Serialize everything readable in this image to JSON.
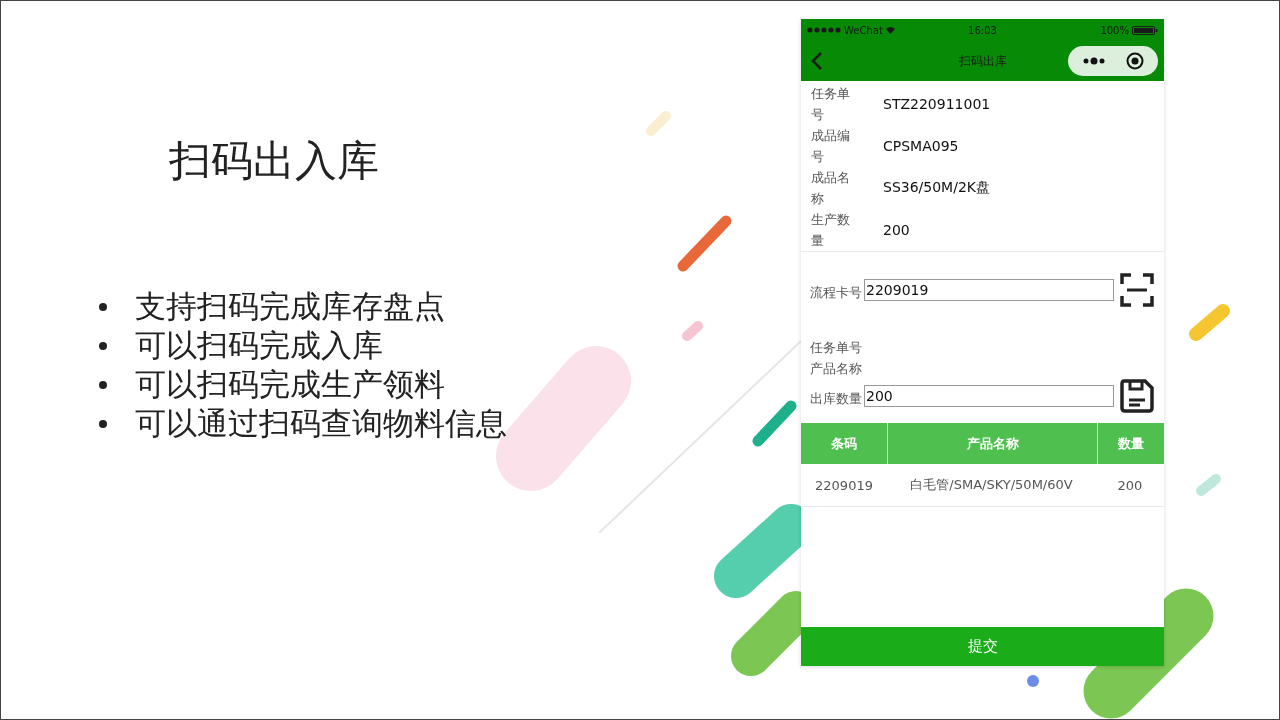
{
  "slide": {
    "title": "扫码出入库",
    "bullets": [
      "支持扫码完成库存盘点",
      "可以扫码完成入库",
      "可以扫码完成生产领料",
      "可以通过扫码查询物料信息"
    ]
  },
  "phone": {
    "status_bar": {
      "carrier": "WeChat",
      "time": "16:03",
      "battery": "100%"
    },
    "nav_title": "扫码出库",
    "info": [
      {
        "label": "任务单号",
        "value": "STZ220911001"
      },
      {
        "label": "成品编号",
        "value": "CPSMA095"
      },
      {
        "label": "成品名称",
        "value": "SS36/50M/2K盘"
      },
      {
        "label": "生产数量",
        "value": "200"
      }
    ],
    "card_field": {
      "label": "流程卡号",
      "value": "2209019"
    },
    "details": [
      "任务单号",
      "产品名称"
    ],
    "quantity_field": {
      "label": "出库数量",
      "value": "200"
    },
    "table": {
      "columns": [
        "条码",
        "产品名称",
        "数量"
      ],
      "rows": [
        [
          "2209019",
          "白毛管/SMA/SKY/50M/60V",
          "200"
        ]
      ]
    },
    "submit": "提交"
  }
}
